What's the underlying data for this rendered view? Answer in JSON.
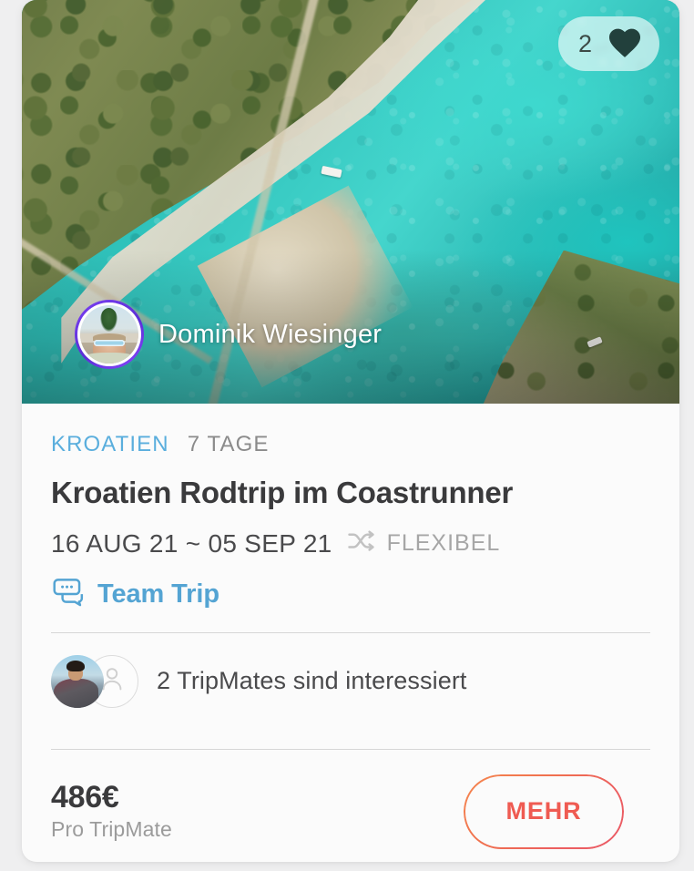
{
  "card": {
    "hero": {
      "image_alt": "aerial-coastline-photo",
      "favorites": {
        "count": "2",
        "icon": "heart-icon"
      },
      "host": {
        "name": "Dominik Wiesinger",
        "avatar_alt": "host-avatar-photo",
        "ring_color": "#6b33e8"
      }
    },
    "meta": {
      "destination": "KROATIEN",
      "destination_color": "#5aaedd",
      "duration": "7 TAGE",
      "duration_color": "#8b8b8b"
    },
    "title": "Kroatien Rodtrip im Coastrunner",
    "dates": {
      "range": "16 AUG 21 ~ 05 SEP 21",
      "flexible_label": "FLEXIBEL",
      "flexible_icon": "shuffle-icon"
    },
    "team": {
      "label": "Team Trip",
      "icon": "chat-bubbles-icon",
      "color": "#54a4d3"
    },
    "tripmates": {
      "text": "2 TripMates sind interessiert",
      "avatar_1_alt": "tripmate-avatar-photo",
      "avatar_2_alt": "tripmate-avatar-placeholder"
    },
    "price": {
      "value": "486€",
      "caption": "Pro TripMate"
    },
    "cta": {
      "label": "MEHR",
      "accent_color": "#ef5b52"
    }
  }
}
